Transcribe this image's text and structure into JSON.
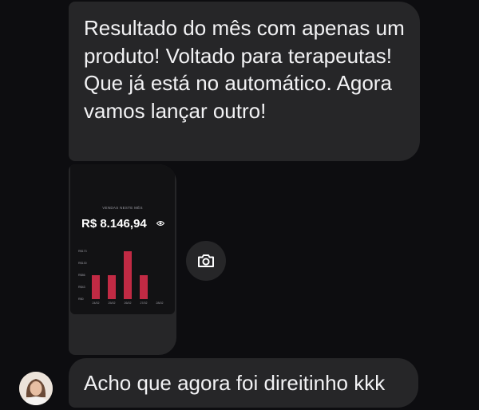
{
  "messages": {
    "first": "Resultado do mês com apenas um produto! Voltado para terapeutas! Que já está no automático. Agora vamos lançar outro!",
    "last": "Acho que agora foi direitinho kkk"
  },
  "attachment": {
    "caption": "VENDAS NESTE MÊS",
    "amount": "R$ 8.146,94",
    "icons": [
      "eye-icon",
      "camera-icon"
    ],
    "chart_data": {
      "type": "bar",
      "categories": [
        "24/02",
        "25/02",
        "26/02",
        "27/02",
        "28/02"
      ],
      "values": [
        2,
        2,
        4,
        2,
        0
      ],
      "ylabels": [
        "R$173",
        "R$130",
        "R$86",
        "R$43",
        "R$0"
      ],
      "bar_color": "#c12a44"
    }
  },
  "colors": {
    "background": "#0d0d10",
    "bubble": "#262628",
    "text": "#f2f2f4"
  }
}
